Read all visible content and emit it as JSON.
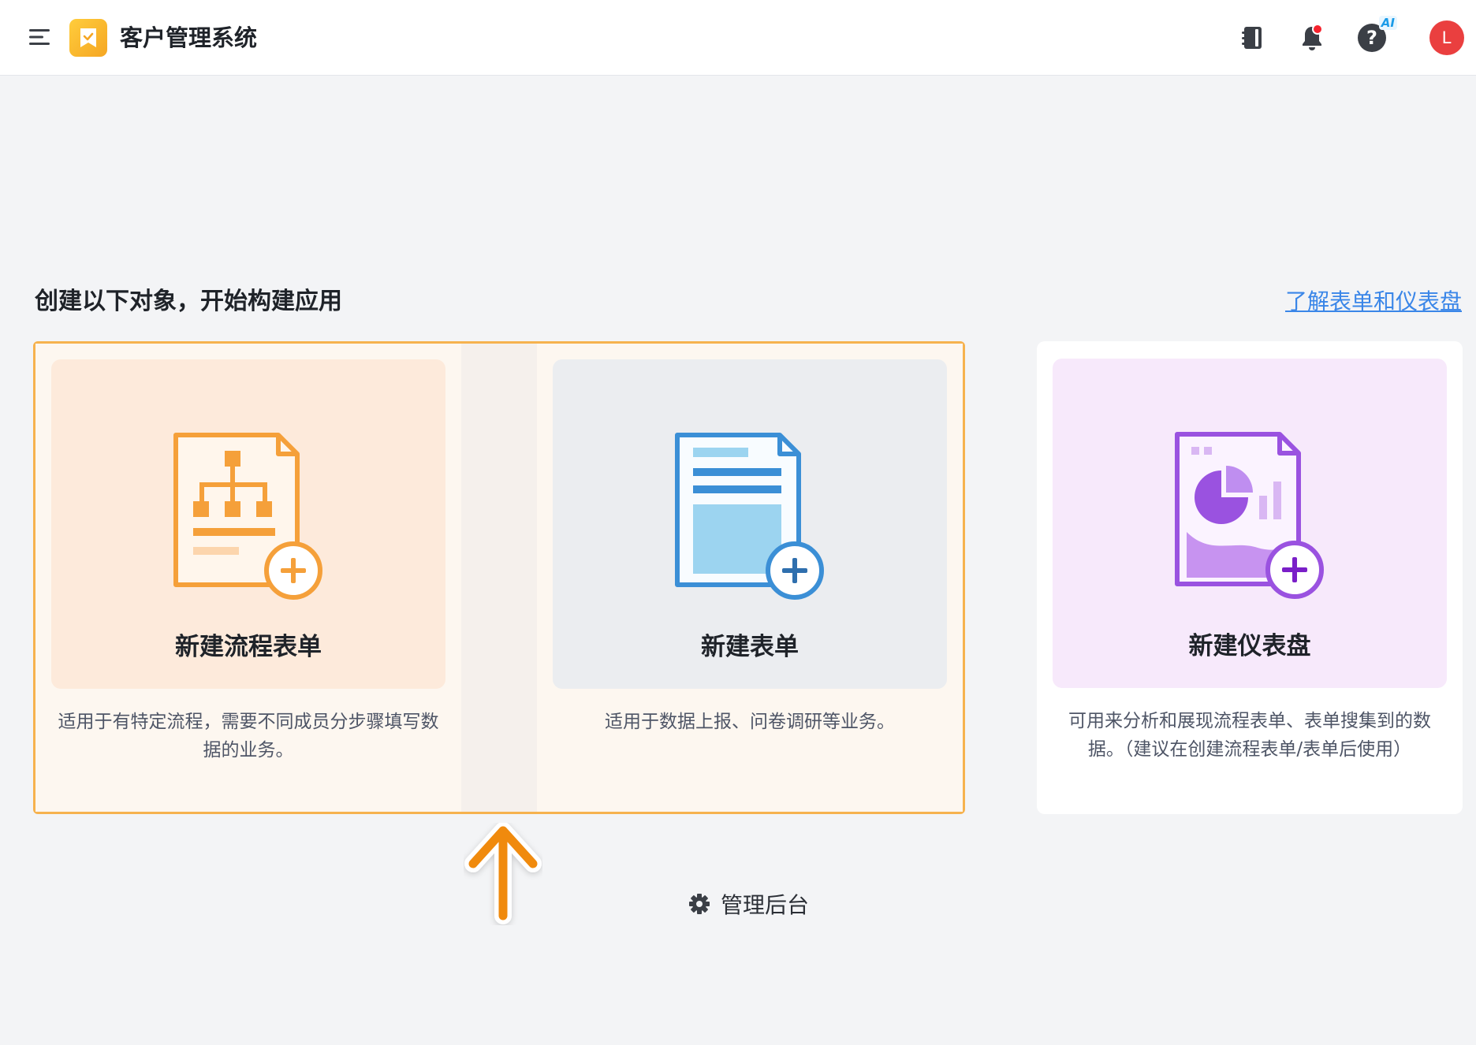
{
  "header": {
    "app_title": "客户管理系统",
    "menu_icon": "hamburger-menu-icon",
    "logo_icon": "bookmark-check-icon",
    "actions": [
      {
        "name": "notebook-icon"
      },
      {
        "name": "bell-icon",
        "has_dot": true
      },
      {
        "name": "help-icon",
        "badge": "AI"
      }
    ],
    "avatar_initial": "L",
    "avatar_color": "#ea3f3f"
  },
  "section": {
    "title": "创建以下对象，开始构建应用",
    "learn_link": "了解表单和仪表盘"
  },
  "cards": [
    {
      "label": "新建流程表单",
      "description": "适用于有特定流程，需要不同成员分步骤填写数据的业务。",
      "icon": "process-form-icon",
      "accent": "#f5a03a",
      "bg": "#fdeadb"
    },
    {
      "label": "新建表单",
      "description": "适用于数据上报、问卷调研等业务。",
      "icon": "form-icon",
      "accent": "#3b8fd6",
      "bg": "#ebedf0"
    },
    {
      "label": "新建仪表盘",
      "description": "可用来分析和展现流程表单、表单搜集到的数据。（建议在创建流程表单/表单后使用）",
      "icon": "dashboard-icon",
      "accent": "#9a52e0",
      "bg": "#f7e9fb"
    }
  ],
  "admin": {
    "label": "管理后台",
    "icon": "gear-icon"
  },
  "colors": {
    "highlight_border": "#f6b24e",
    "arrow": "#f08a0c",
    "link": "#3a86e8"
  }
}
